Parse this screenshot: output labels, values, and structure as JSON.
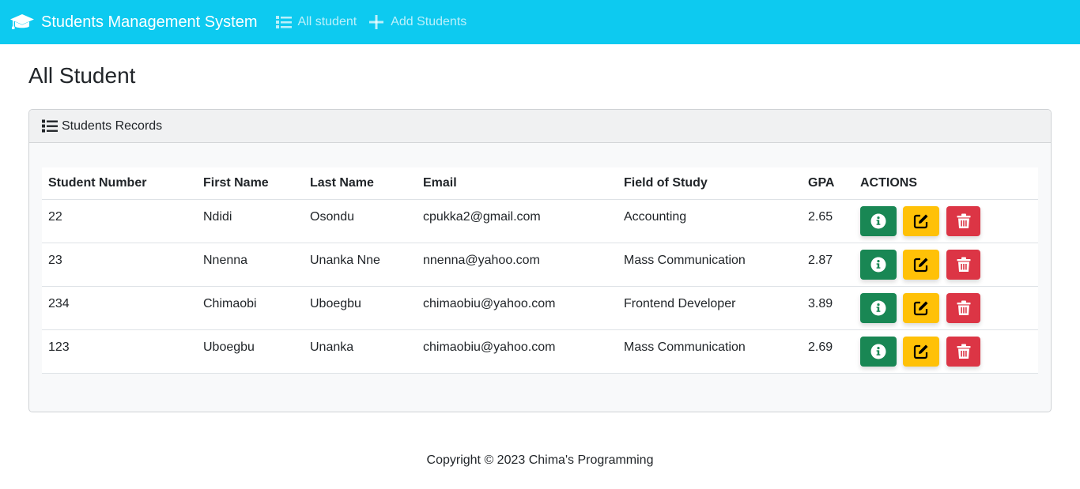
{
  "navbar": {
    "brand": "Students Management System",
    "brand_icon": "graduation-cap-icon",
    "links": [
      {
        "label": "All student",
        "icon": "list-icon"
      },
      {
        "label": "Add Students",
        "icon": "plus-icon"
      }
    ],
    "bg_color": "#0dcaf0"
  },
  "page": {
    "title": "All Student"
  },
  "card": {
    "header": "Students Records",
    "header_icon": "list-icon"
  },
  "table": {
    "columns": [
      "Student Number",
      "First Name",
      "Last Name",
      "Email",
      "Field of Study",
      "GPA",
      "ACTIONS"
    ],
    "rows": [
      {
        "number": "22",
        "first": "Ndidi",
        "last": "Osondu",
        "email": "cpukka2@gmail.com",
        "field": "Accounting",
        "gpa": "2.65"
      },
      {
        "number": "23",
        "first": "Nnenna",
        "last": "Unanka Nne",
        "email": "nnenna@yahoo.com",
        "field": "Mass Communication",
        "gpa": "2.87"
      },
      {
        "number": "234",
        "first": "Chimaobi",
        "last": "Uboegbu",
        "email": "chimaobiu@yahoo.com",
        "field": "Frontend Developer",
        "gpa": "3.89"
      },
      {
        "number": "123",
        "first": "Uboegbu",
        "last": "Unanka",
        "email": "chimaobiu@yahoo.com",
        "field": "Mass Communication",
        "gpa": "2.69"
      }
    ],
    "actions": [
      {
        "name": "info",
        "icon": "info-circle-icon",
        "color": "#198754"
      },
      {
        "name": "edit",
        "icon": "pen-to-square-icon",
        "color": "#ffc107"
      },
      {
        "name": "delete",
        "icon": "trash-can-icon",
        "color": "#dc3545"
      }
    ]
  },
  "footer": {
    "text": "Copyright © 2023 Chima's Programming"
  }
}
